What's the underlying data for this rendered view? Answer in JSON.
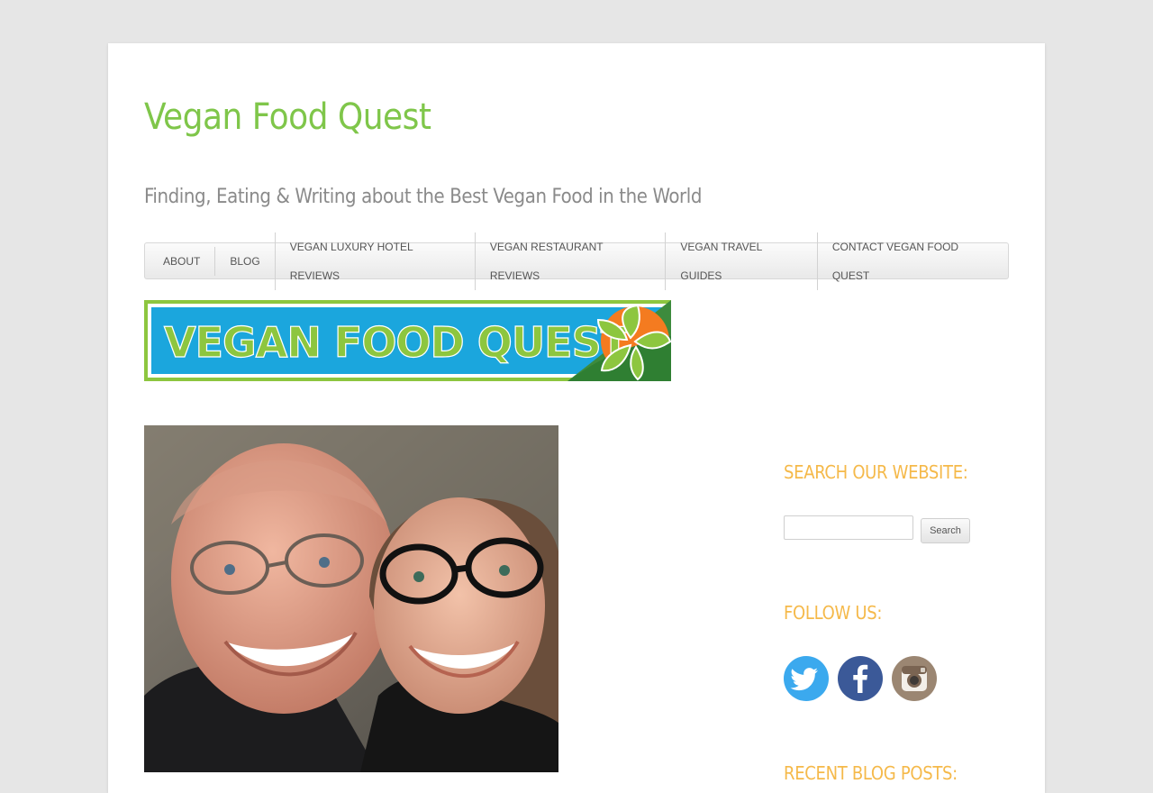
{
  "site": {
    "title": "Vegan Food Quest",
    "tagline": "Finding, Eating & Writing about the Best Vegan Food in the World",
    "brand_color": "#7fc64a",
    "accent_color": "#f5b94a"
  },
  "nav": {
    "items": [
      {
        "label": "ABOUT"
      },
      {
        "label": "BLOG"
      },
      {
        "label": "VEGAN LUXURY HOTEL REVIEWS"
      },
      {
        "label": "VEGAN RESTAURANT REVIEWS"
      },
      {
        "label": "VEGAN TRAVEL GUIDES"
      },
      {
        "label": "CONTACT VEGAN FOOD QUEST"
      }
    ]
  },
  "banner": {
    "text": "VEGAN FOOD QUEST",
    "colors": {
      "background": "#1ba6dd",
      "frame": "#8dc63f",
      "text": "#8dc63f",
      "sun": "#f47b20"
    }
  },
  "sidebar": {
    "search": {
      "title": "SEARCH OUR WEBSITE:",
      "input_value": "",
      "placeholder": "",
      "button_label": "Search"
    },
    "follow": {
      "title": "FOLLOW US:",
      "icons": [
        {
          "name": "twitter-icon",
          "color": "#3ba9ee"
        },
        {
          "name": "facebook-icon",
          "color": "#3b5998"
        },
        {
          "name": "instagram-icon",
          "color": "#9b8672"
        }
      ]
    },
    "recent": {
      "title": "RECENT BLOG POSTS:"
    }
  }
}
